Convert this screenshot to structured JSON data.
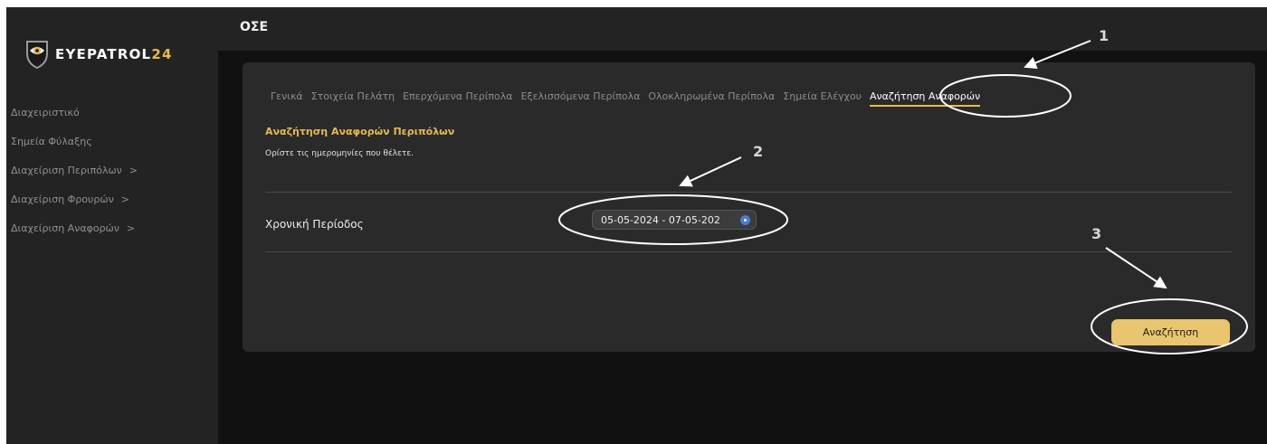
{
  "app": {
    "logo_text_main": "EYEPATROL",
    "logo_text_accent": "24"
  },
  "sidebar": {
    "items": [
      {
        "label": "Διαχειριστικό",
        "chevron": ""
      },
      {
        "label": "Σημεία Φύλαξης",
        "chevron": ""
      },
      {
        "label": "Διαχείριση Περιπόλων",
        "chevron": ">"
      },
      {
        "label": "Διαχείριση Φρουρών",
        "chevron": ">"
      },
      {
        "label": "Διαχείριση Αναφορών",
        "chevron": ">"
      }
    ]
  },
  "header": {
    "title": "ΟΣΕ"
  },
  "tabs": [
    {
      "label": "Γενικά"
    },
    {
      "label": "Στοιχεία Πελάτη"
    },
    {
      "label": "Επερχόμενα Περίπολα"
    },
    {
      "label": "Εξελισσόμενα Περίπολα"
    },
    {
      "label": "Ολοκληρωμένα Περίπολα"
    },
    {
      "label": "Σημεία Ελέγχου"
    },
    {
      "label": "Αναζήτηση Αναφορών",
      "active": true
    }
  ],
  "section": {
    "title": "Αναζήτηση Αναφορών Περιπόλων",
    "description": "Ορίστε τις ημερομηνίες που θέλετε."
  },
  "form": {
    "period_label": "Χρονική Περίοδος",
    "date_range_value": "05-05-2024 - 07-05-202"
  },
  "actions": {
    "search_label": "Αναζήτηση"
  },
  "annotations": {
    "numbers": [
      "1",
      "2",
      "3"
    ]
  },
  "colors": {
    "accent": "#e6b94f",
    "button": "#e8c56e",
    "sidebar_bg": "#232323",
    "card_bg": "#2a2a2a",
    "page_bg": "#111111"
  }
}
